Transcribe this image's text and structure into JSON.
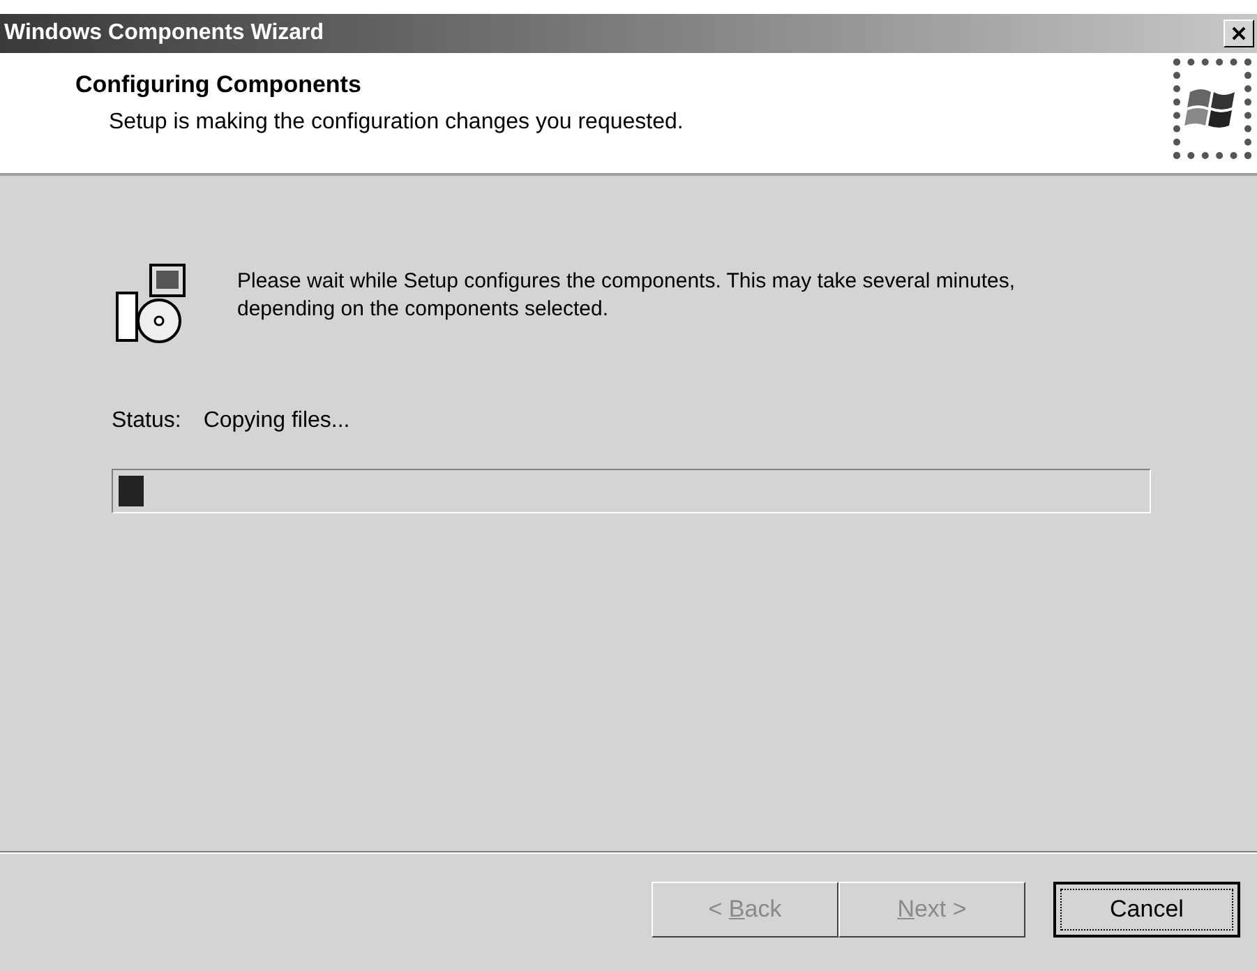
{
  "window": {
    "title": "Windows Components Wizard"
  },
  "header": {
    "title": "Configuring Components",
    "subtitle": "Setup is making the configuration changes you requested."
  },
  "message": "Please wait while Setup configures the components. This may take several minutes, depending on the components selected.",
  "status": {
    "label": "Status:",
    "value": "Copying files..."
  },
  "progress": {
    "level": 0.025
  },
  "buttons": [
    {
      "label_parts": [
        {
          "text": "< ",
          "underline": false
        },
        {
          "text": "B",
          "underline": true
        },
        {
          "text": "ack",
          "underline": false
        }
      ],
      "disabled": true,
      "default": false
    },
    {
      "label_parts": [
        {
          "text": "N",
          "underline": true
        },
        {
          "text": "ext >",
          "underline": false
        }
      ],
      "disabled": true,
      "default": false
    },
    {
      "label_parts": [
        {
          "text": "Cancel",
          "underline": false
        }
      ],
      "disabled": false,
      "default": true
    }
  ]
}
